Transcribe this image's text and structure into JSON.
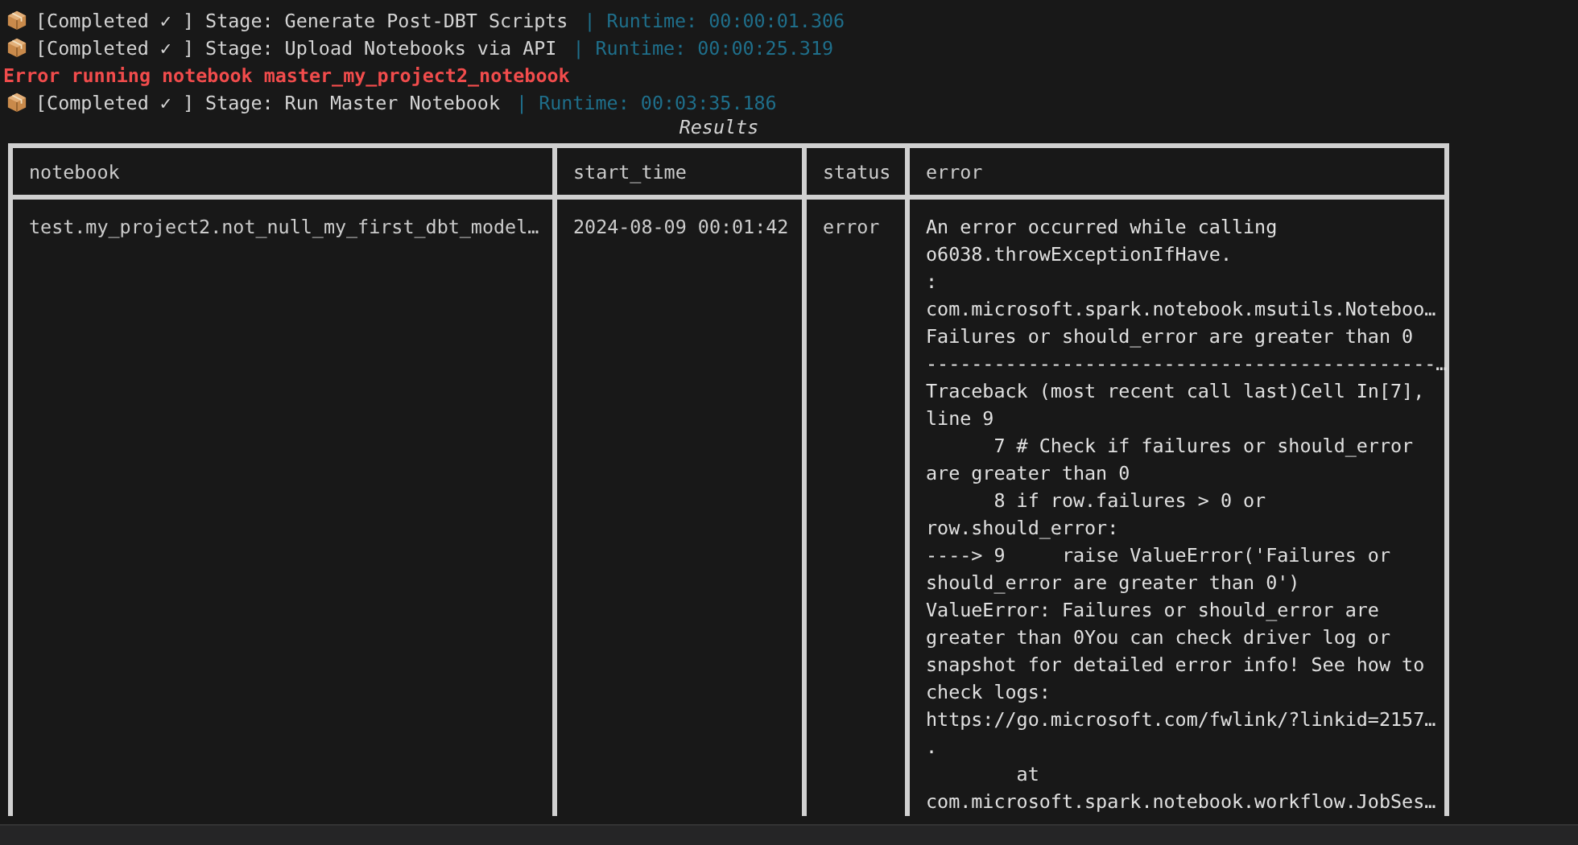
{
  "log_lines": [
    {
      "kind": "stage",
      "status": "[Completed ✓ ] Stage: Generate Post-DBT Scripts",
      "runtime": "| Runtime: 00:00:01.306"
    },
    {
      "kind": "stage",
      "status": "[Completed ✓ ] Stage: Upload Notebooks via API",
      "runtime": "| Runtime: 00:00:25.319"
    },
    {
      "kind": "error",
      "text": "Error running notebook master_my_project2_notebook"
    },
    {
      "kind": "stage",
      "status": "[Completed ✓ ] Stage: Run Master Notebook",
      "runtime": "| Runtime: 00:03:35.186"
    }
  ],
  "results": {
    "title": "Results",
    "columns": [
      "notebook",
      "start_time",
      "status",
      "error"
    ],
    "rows": [
      {
        "notebook": "test.my_project2.not_null_my_first_dbt_model…",
        "start_time": "2024-08-09 00:01:42",
        "status": "error",
        "error": [
          "An error occurred while calling",
          "o6038.throwExceptionIfHave.",
          ":",
          "com.microsoft.spark.notebook.msutils.Noteboo…",
          "Failures or should_error are greater than 0",
          "---------------------------------------------…",
          "Traceback (most recent call last)Cell In[7],",
          "line 9",
          "      7 # Check if failures or should_error",
          "are greater than 0",
          "      8 if row.failures > 0 or",
          "row.should_error:",
          "----> 9     raise ValueError('Failures or",
          "should_error are greater than 0')",
          "ValueError: Failures or should_error are",
          "greater than 0You can check driver log or",
          "snapshot for detailed error info! See how to",
          "check logs:",
          "https://go.microsoft.com/fwlink/?linkid=2157…",
          ".",
          "        at",
          "com.microsoft.spark.notebook.workflow.JobSes…"
        ]
      }
    ]
  }
}
